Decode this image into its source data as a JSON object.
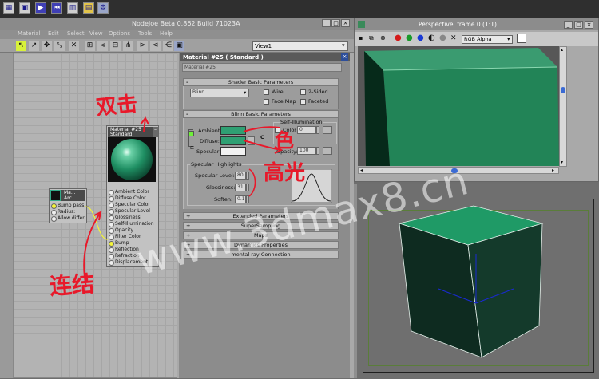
{
  "toolbar_icons": [
    "open-file-icon",
    "save-icon",
    "play-icon",
    "skip-back-icon",
    "book-icon",
    "grid-icon",
    "gear-icon"
  ],
  "nodejoe": {
    "title": "NodeJoe Beta 0.862 Build 71023A",
    "menu": [
      "Material",
      "Edit",
      "Select",
      "View",
      "Options",
      "Tools",
      "Help"
    ],
    "view_select": "View1",
    "main_node": {
      "title": "Material #25",
      "subtitle": "Standard",
      "slots": [
        "Ambient Color",
        "Diffuse Color",
        "Specular Color",
        "Specular Level",
        "Glossiness",
        "Self-Illumination",
        "Opacity",
        "Filter Color",
        "Bump",
        "Reflection",
        "Refraction",
        "Displacement"
      ]
    },
    "small_node": {
      "title": "Ma...",
      "subtitle": "Arc...",
      "slots": [
        "Bump pass...",
        "Radius:",
        "Allow differ..."
      ]
    }
  },
  "material": {
    "title": "Material #25  ( Standard )",
    "name_field": "Material #25",
    "rollout_shader": "Shader Basic Parameters",
    "shader_type": "Blinn",
    "opt_wire": "Wire",
    "opt_2sided": "2-Sided",
    "opt_facemap": "Face Map",
    "opt_faceted": "Faceted",
    "rollout_blinn": "Blinn Basic Parameters",
    "self_illum_label": "Self-Illumination",
    "color_label": "Color",
    "color_value": "0",
    "ambient": "Ambient:",
    "diffuse": "Diffuse:",
    "specular": "Specular:",
    "opacity_label": "Opacity:",
    "opacity_value": "100",
    "lock_letter": "C",
    "spec_highlights": "Specular Highlights",
    "spec_level_label": "Specular Level:",
    "spec_level_value": "80",
    "gloss_label": "Glossiness:",
    "gloss_value": "31",
    "soften_label": "Soften:",
    "soften_value": "0.1",
    "rollouts": [
      "Extended Parameters",
      "SuperSampling",
      "Maps",
      "Dynamics Properties",
      "mental ray Connection"
    ],
    "ambient_color": "#2fa073",
    "diffuse_color": "#2fa073",
    "specular_color": "#f2f2f2"
  },
  "perspective": {
    "title": "Perspective, frame 0 (1:1)",
    "channel_select": "RGB Alpha"
  },
  "watermark": "www.3dmax8.cn",
  "annotations": {
    "double_click": "双击",
    "connect": "连结",
    "color": "色",
    "highlight": "高光"
  }
}
